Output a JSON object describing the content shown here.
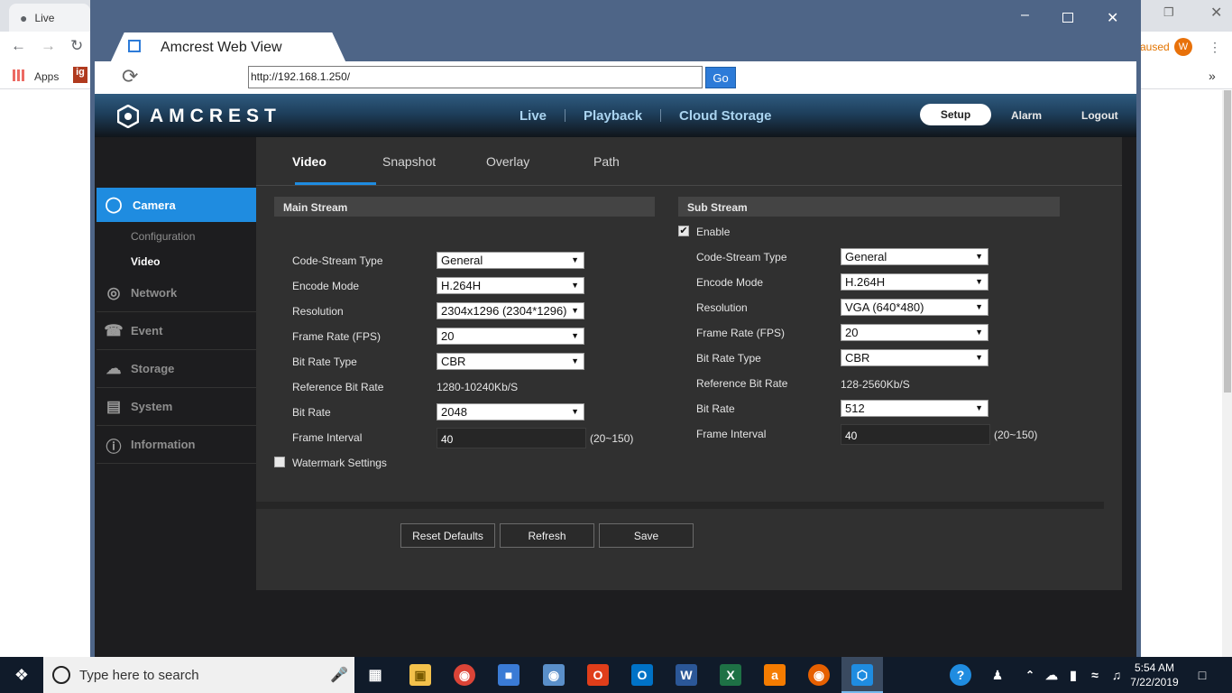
{
  "chrome": {
    "tab_title": "Live",
    "bookmarks_label": "Apps",
    "paused_label": "aused",
    "profile_initial": "W"
  },
  "window": {
    "title": "Amcrest Web View",
    "url": "http://192.168.1.250/",
    "go_label": "Go"
  },
  "header": {
    "logo_text": "AMCREST",
    "nav": [
      "Live",
      "Playback",
      "Cloud Storage"
    ],
    "setup_label": "Setup",
    "alarm_label": "Alarm",
    "logout_label": "Logout"
  },
  "sidebar": {
    "active": "Camera",
    "sub_items": [
      "Configuration",
      "Video"
    ],
    "items": [
      "Network",
      "Event",
      "Storage",
      "System",
      "Information"
    ]
  },
  "tabs": [
    "Video",
    "Snapshot",
    "Overlay",
    "Path"
  ],
  "main_stream": {
    "title": "Main Stream",
    "labels": [
      "Code-Stream Type",
      "Encode Mode",
      "Resolution",
      "Frame Rate (FPS)",
      "Bit Rate Type",
      "Reference Bit Rate",
      "Bit Rate",
      "Frame Interval"
    ],
    "code_stream_type": "General",
    "encode_mode": "H.264H",
    "resolution": "2304x1296 (2304*1296)",
    "frame_rate": "20",
    "bit_rate_type": "CBR",
    "reference_bit_rate": "1280-10240Kb/S",
    "bit_rate": "2048",
    "frame_interval": "40",
    "frame_interval_range": "(20~150)",
    "watermark_label": "Watermark Settings"
  },
  "sub_stream": {
    "title": "Sub Stream",
    "enable_label": "Enable",
    "labels": [
      "Code-Stream Type",
      "Encode Mode",
      "Resolution",
      "Frame Rate (FPS)",
      "Bit Rate Type",
      "Reference Bit Rate",
      "Bit Rate",
      "Frame Interval"
    ],
    "code_stream_type": "General",
    "encode_mode": "H.264H",
    "resolution": "VGA (640*480)",
    "frame_rate": "20",
    "bit_rate_type": "CBR",
    "reference_bit_rate": "128-2560Kb/S",
    "bit_rate": "512",
    "frame_interval": "40",
    "frame_interval_range": "(20~150)"
  },
  "buttons": {
    "reset": "Reset Defaults",
    "refresh": "Refresh",
    "save": "Save"
  },
  "taskbar": {
    "search_placeholder": "Type here to search",
    "time": "5:54 AM",
    "date": "7/22/2019"
  },
  "colors": {
    "accent": "#1f8ce0",
    "window_frame": "#4e6587",
    "taskbar": "#101b2a"
  }
}
